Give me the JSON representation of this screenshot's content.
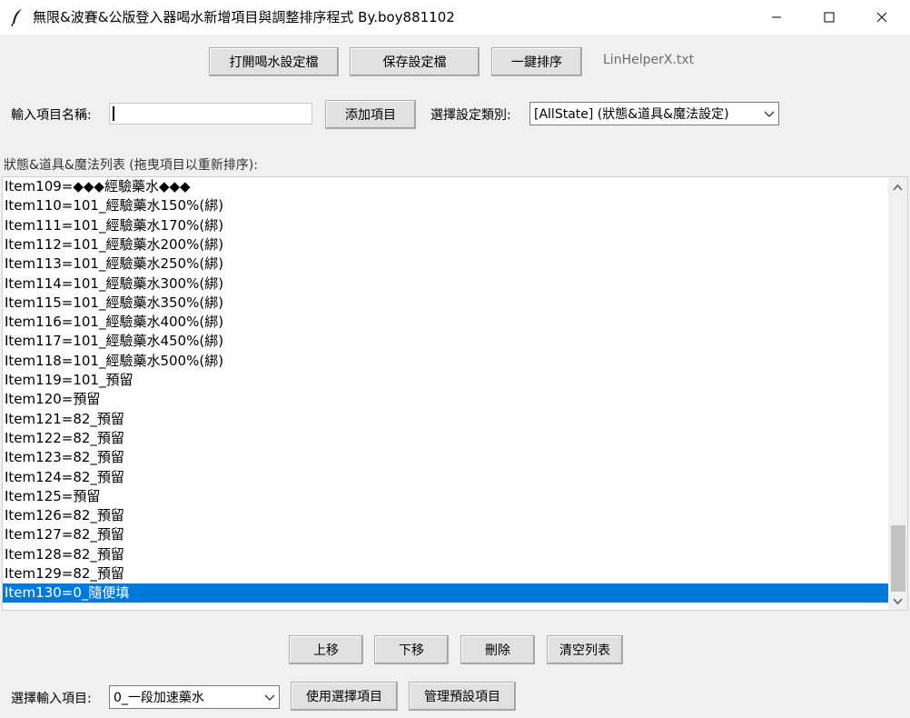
{
  "window": {
    "title": "無限&波賽&公版登入器喝水新增項目與調整排序程式 By.boy881102",
    "icons": [
      "feather-icon",
      "minimize-icon",
      "maximize-icon",
      "close-icon"
    ]
  },
  "toolbar": {
    "open_label": "打開喝水設定檔",
    "save_label": "保存設定檔",
    "sort_label": "一鍵排序",
    "filename": "LinHelperX.txt"
  },
  "input_row": {
    "name_label": "輸入項目名稱:",
    "name_value": "",
    "add_label": "添加項目",
    "category_label": "選擇設定類別:",
    "category_value": "[AllState] (狀態&道具&魔法設定)"
  },
  "list": {
    "heading": "狀態&道具&魔法列表 (拖曳項目以重新排序):",
    "items": [
      "Item109=◆◆◆經驗藥水◆◆◆",
      "Item110=101_經驗藥水150%(綁)",
      "Item111=101_經驗藥水170%(綁)",
      "Item112=101_經驗藥水200%(綁)",
      "Item113=101_經驗藥水250%(綁)",
      "Item114=101_經驗藥水300%(綁)",
      "Item115=101_經驗藥水350%(綁)",
      "Item116=101_經驗藥水400%(綁)",
      "Item117=101_經驗藥水450%(綁)",
      "Item118=101_經驗藥水500%(綁)",
      "Item119=101_預留",
      "Item120=預留",
      "Item121=82_預留",
      "Item122=82_預留",
      "Item123=82_預留",
      "Item124=82_預留",
      "Item125=預留",
      "Item126=82_預留",
      "Item127=82_預留",
      "Item128=82_預留",
      "Item129=82_預留",
      "Item130=0_隨便填"
    ],
    "selected_index": 21,
    "selection_color": "#0078d7"
  },
  "actions": {
    "up_label": "上移",
    "down_label": "下移",
    "delete_label": "刪除",
    "clear_label": "清空列表"
  },
  "bottom_row": {
    "select_label": "選擇輸入項目:",
    "select_value": "0_一段加速藥水",
    "use_label": "使用選擇項目",
    "manage_label": "管理預設項目"
  }
}
